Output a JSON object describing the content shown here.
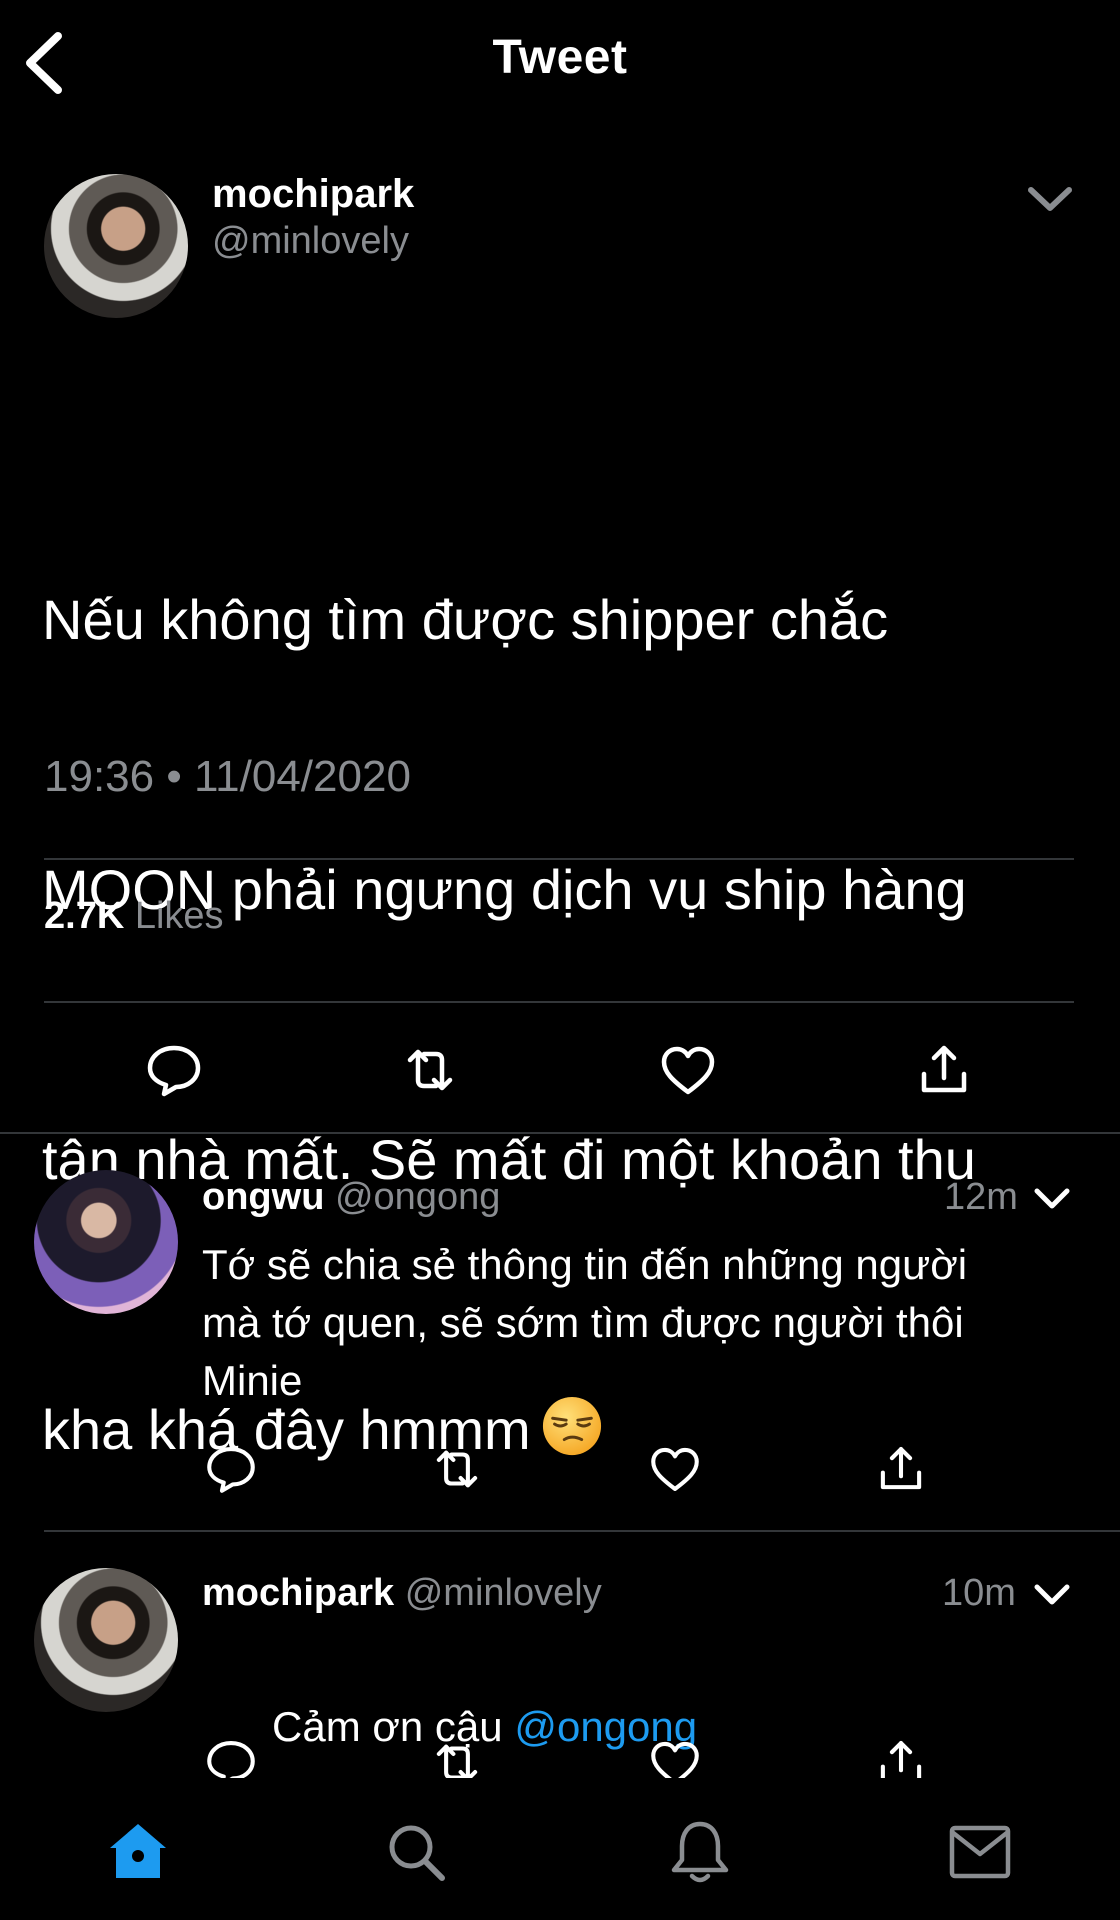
{
  "header": {
    "title": "Tweet",
    "back_icon": "chevron-left-icon"
  },
  "main_tweet": {
    "author_name": "mochipark",
    "author_handle": "@minlovely",
    "text_line1": "Nếu không tìm được shipper chắc",
    "text_line2": "MOON phải ngưng dịch vụ ship hàng",
    "text_line3": "tận nhà mất. Sẽ mất đi một khoản thu",
    "text_line4": "kha khá đây hmmm",
    "emoji": "unamused-face-emoji",
    "timestamp": "19:36 • 11/04/2020",
    "likes_count": "2.7K",
    "likes_label": "Likes"
  },
  "replies": [
    {
      "author_name": "ongwu",
      "author_handle": "@ongong",
      "time": "12m",
      "text": "Tớ sẽ chia sẻ thông tin đến những người\nmà tớ quen, sẽ sớm tìm được người thôi\nMinie"
    },
    {
      "author_name": "mochipark",
      "author_handle": "@minlovely",
      "time": "10m",
      "text_prefix": "Cảm ơn cậu ",
      "mention": "@ongong"
    }
  ],
  "actions": [
    "reply-icon",
    "retweet-icon",
    "like-icon",
    "share-icon"
  ],
  "bottom_nav": [
    "home-icon",
    "search-icon",
    "notifications-icon",
    "messages-icon"
  ],
  "colors": {
    "background": "#000000",
    "text": "#ffffff",
    "secondary": "#8a8d91",
    "accent": "#1d9bf0",
    "divider": "#333639"
  }
}
